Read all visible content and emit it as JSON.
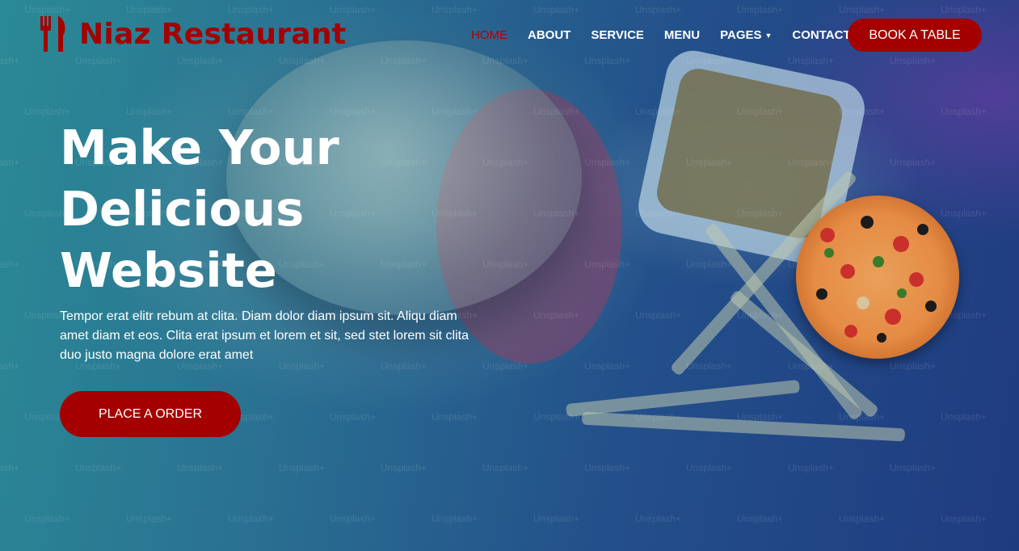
{
  "brand": {
    "name": "Niaz Restaurant",
    "icon": "utensils-icon",
    "color": "#a40000"
  },
  "nav": {
    "items": [
      {
        "label": "HOME",
        "active": true
      },
      {
        "label": "ABOUT"
      },
      {
        "label": "SERVICE"
      },
      {
        "label": "MENU"
      },
      {
        "label": "PAGES",
        "dropdown": true
      },
      {
        "label": "CONTACT"
      }
    ],
    "cta": "BOOK A TABLE"
  },
  "hero": {
    "title_lines": [
      "Make Your",
      "Delicious",
      "Website"
    ],
    "description": "Tempor erat elitr rebum at clita. Diam dolor diam ipsum sit. Aliqu diam amet diam et eos. Clita erat ipsum et lorem et sit, sed stet lorem sit clita duo justo magna dolore erat amet",
    "cta": "PLACE A ORDER"
  },
  "watermark": "Unsplash+",
  "colors": {
    "accent": "#a40000",
    "active_nav": "#b40000",
    "text": "#ffffff"
  }
}
